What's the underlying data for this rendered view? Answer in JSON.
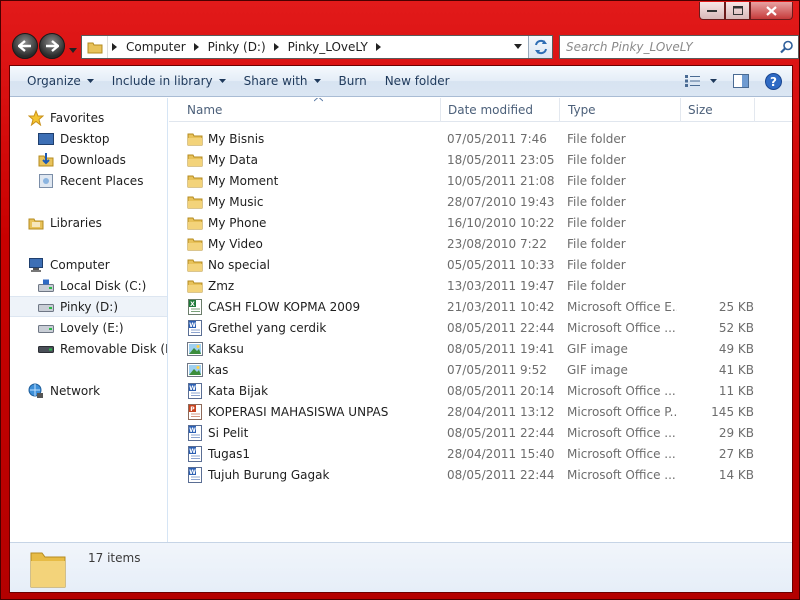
{
  "window": {
    "colors": {
      "frame": "#c80000",
      "toolbar": "#dbe6f3",
      "text_muted": "#6d6d6d"
    }
  },
  "address": {
    "crumbs": [
      "Computer",
      "Pinky (D:)",
      "Pinky_LOveLY"
    ]
  },
  "search": {
    "placeholder": "Search Pinky_LOveLY"
  },
  "toolbar": {
    "organize": "Organize",
    "include_in_library": "Include in library",
    "share_with": "Share with",
    "burn": "Burn",
    "new_folder": "New folder"
  },
  "navpane": {
    "favorites": "Favorites",
    "desktop": "Desktop",
    "downloads": "Downloads",
    "recent_places": "Recent Places",
    "libraries": "Libraries",
    "computer": "Computer",
    "local_disk": "Local Disk (C:)",
    "pinky": "Pinky (D:)",
    "lovely": "Lovely (E:)",
    "removable": "Removable Disk (H:)",
    "network": "Network"
  },
  "columns": {
    "name": "Name",
    "date": "Date modified",
    "type": "Type",
    "size": "Size"
  },
  "files": [
    {
      "name": "My Bisnis",
      "date": "07/05/2011 7:46",
      "type": "File folder",
      "size": "",
      "icon": "folder-icon"
    },
    {
      "name": "My Data",
      "date": "18/05/2011 23:05",
      "type": "File folder",
      "size": "",
      "icon": "folder-icon"
    },
    {
      "name": "My Moment",
      "date": "10/05/2011 21:08",
      "type": "File folder",
      "size": "",
      "icon": "folder-icon"
    },
    {
      "name": "My Music",
      "date": "28/07/2010 19:43",
      "type": "File folder",
      "size": "",
      "icon": "folder-icon"
    },
    {
      "name": "My Phone",
      "date": "16/10/2010 10:22",
      "type": "File folder",
      "size": "",
      "icon": "folder-icon"
    },
    {
      "name": "My Video",
      "date": "23/08/2010 7:22",
      "type": "File folder",
      "size": "",
      "icon": "folder-icon"
    },
    {
      "name": "No special",
      "date": "05/05/2011 10:33",
      "type": "File folder",
      "size": "",
      "icon": "folder-icon"
    },
    {
      "name": "Zmz",
      "date": "13/03/2011 19:47",
      "type": "File folder",
      "size": "",
      "icon": "folder-icon"
    },
    {
      "name": "CASH FLOW KOPMA 2009",
      "date": "21/03/2011 10:42",
      "type": "Microsoft Office E...",
      "size": "25 KB",
      "icon": "excel-icon"
    },
    {
      "name": "Grethel yang cerdik",
      "date": "08/05/2011 22:44",
      "type": "Microsoft Office ...",
      "size": "52 KB",
      "icon": "word-icon"
    },
    {
      "name": "Kaksu",
      "date": "08/05/2011 19:41",
      "type": "GIF image",
      "size": "49 KB",
      "icon": "image-icon"
    },
    {
      "name": "kas",
      "date": "07/05/2011 9:52",
      "type": "GIF image",
      "size": "41 KB",
      "icon": "image-icon"
    },
    {
      "name": "Kata Bijak",
      "date": "08/05/2011 20:14",
      "type": "Microsoft Office ...",
      "size": "11 KB",
      "icon": "word-icon"
    },
    {
      "name": "KOPERASI MAHASISWA UNPAS",
      "date": "28/04/2011 13:12",
      "type": "Microsoft Office P...",
      "size": "145 KB",
      "icon": "powerpoint-icon"
    },
    {
      "name": "Si Pelit",
      "date": "08/05/2011 22:44",
      "type": "Microsoft Office ...",
      "size": "29 KB",
      "icon": "word-icon"
    },
    {
      "name": "Tugas1",
      "date": "28/04/2011 15:40",
      "type": "Microsoft Office ...",
      "size": "27 KB",
      "icon": "word-icon"
    },
    {
      "name": "Tujuh Burung Gagak",
      "date": "08/05/2011 22:44",
      "type": "Microsoft Office ...",
      "size": "14 KB",
      "icon": "word-icon"
    }
  ],
  "details": {
    "count": "17 items"
  }
}
